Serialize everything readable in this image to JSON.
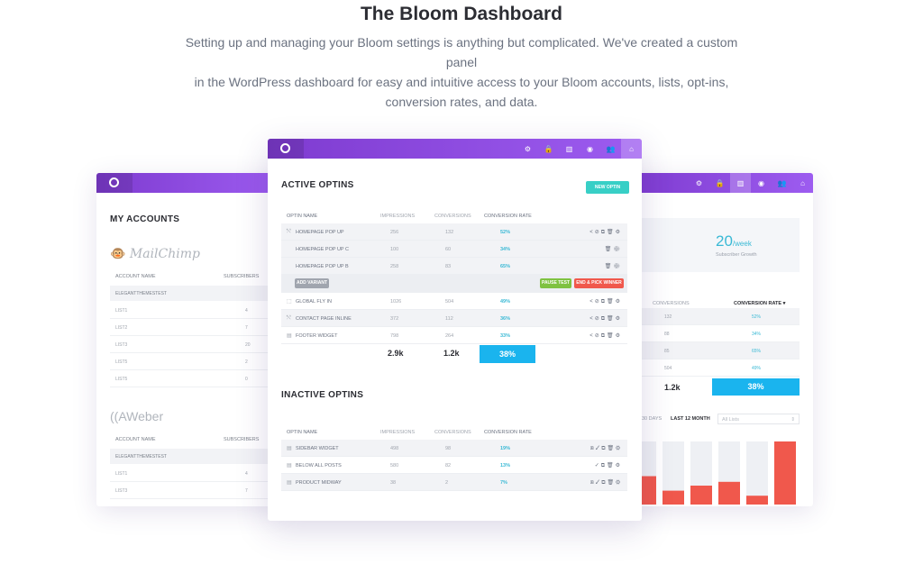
{
  "hero": {
    "title": "The Bloom Dashboard",
    "subtitle_line1": "Setting up and managing your Bloom settings is anything but complicated. We've created a custom panel",
    "subtitle_line2": "in the WordPress dashboard for easy and intuitive access to your Bloom accounts, lists, opt-ins,",
    "subtitle_line3": "conversion rates, and data."
  },
  "nav_icons": [
    "gear-icon",
    "lock-icon",
    "bar-chart-icon",
    "globe-icon",
    "users-icon",
    "home-icon"
  ],
  "colors": {
    "purple": "#8a45dc",
    "accent_blue": "#39b9d5",
    "total_blue": "#1ab4ee",
    "teal_button": "#38cfc6",
    "green_button": "#7fc241",
    "red_button": "#f0584c",
    "bar_red": "#f0584c",
    "bar_grey": "#eef0f4"
  },
  "left": {
    "heading": "My Accounts",
    "mailchimp": {
      "brand": "MailChimp",
      "col_name": "Account Name",
      "col_subs": "Subscribers",
      "group": "Elegantthemestest",
      "rows": [
        {
          "name": "List1",
          "count": "4"
        },
        {
          "name": "List2",
          "count": "7"
        },
        {
          "name": "List3",
          "count": "20"
        },
        {
          "name": "List5",
          "count": "2"
        },
        {
          "name": "List5",
          "count": "0"
        }
      ]
    },
    "aweber": {
      "brand": "AWeber",
      "col_name": "Account Name",
      "col_subs": "Subscribers",
      "group": "Elegantthemestest",
      "rows": [
        {
          "name": "List1",
          "count": "4"
        },
        {
          "name": "List3",
          "count": "7"
        }
      ]
    }
  },
  "center": {
    "active_heading": "Active Optins",
    "new_optin": "New Optin",
    "headers": [
      "Optin Name",
      "Impressions",
      "Conversions",
      "Conversion Rate"
    ],
    "active_rows": [
      {
        "icon": "⤲",
        "name": "Homepage Pop Up",
        "imp": "256",
        "conv": "132",
        "rate": "52%",
        "acts": "<⊘⧉🗑⚙",
        "alt": true
      },
      {
        "icon": "",
        "name": "Homepage Pop Up C",
        "imp": "100",
        "conv": "60",
        "rate": "34%",
        "acts": "🗑⚙",
        "alt": true
      },
      {
        "icon": "",
        "name": "Homepage Pop Up B",
        "imp": "258",
        "conv": "83",
        "rate": "65%",
        "acts": "🗑⚙",
        "alt": true
      }
    ],
    "add_variant": "Add Variant",
    "pause_test": "Pause Test",
    "end_pick": "End & Pick Winner",
    "active_rows2": [
      {
        "icon": "⬚",
        "name": "Global Fly In",
        "imp": "1026",
        "conv": "504",
        "rate": "49%",
        "acts": "<⊘⧉🗑⚙",
        "alt": false
      },
      {
        "icon": "⤲",
        "name": "Contact Page Inline",
        "imp": "372",
        "conv": "112",
        "rate": "36%",
        "acts": "<⊘⧉🗑⚙",
        "alt": true
      },
      {
        "icon": "▤",
        "name": "Footer Widget",
        "imp": "798",
        "conv": "264",
        "rate": "33%",
        "acts": "<⊘⧉🗑⚙",
        "alt": false
      }
    ],
    "totals": {
      "imp": "2.9k",
      "conv": "1.2k",
      "rate": "38%"
    },
    "inactive_heading": "Inactive Optins",
    "inactive_rows": [
      {
        "icon": "▤",
        "name": "Sidebar Widget",
        "imp": "498",
        "conv": "98",
        "rate": "19%",
        "acts": "⧈✓⧉🗑⚙",
        "alt": true
      },
      {
        "icon": "▤",
        "name": "Below All Posts",
        "imp": "580",
        "conv": "82",
        "rate": "13%",
        "acts": "✓⧉🗑⚙",
        "alt": false
      },
      {
        "icon": "▤",
        "name": "Product Midway",
        "imp": "38",
        "conv": "2",
        "rate": "7%",
        "acts": "⧈✓⧉🗑⚙",
        "alt": true
      }
    ]
  },
  "right": {
    "stat_value": "20",
    "stat_unit": "/week",
    "stat_label": "Subscriber Growth",
    "col_conv": "Conversions",
    "col_rate": "Conversion Rate ▾",
    "rows": [
      {
        "conv": "132",
        "rate": "52%"
      },
      {
        "conv": "88",
        "rate": "34%"
      },
      {
        "conv": "85",
        "rate": "65%"
      },
      {
        "conv": "504",
        "rate": "49%"
      }
    ],
    "total_conv": "1.2k",
    "total_rate": "38%",
    "period_days": "30 Days",
    "period_month": "Last 12 Month",
    "list_select": "All Lists",
    "bar_values": [
      0.45,
      0.22,
      0.3,
      0.36,
      0.14,
      1.0
    ]
  }
}
